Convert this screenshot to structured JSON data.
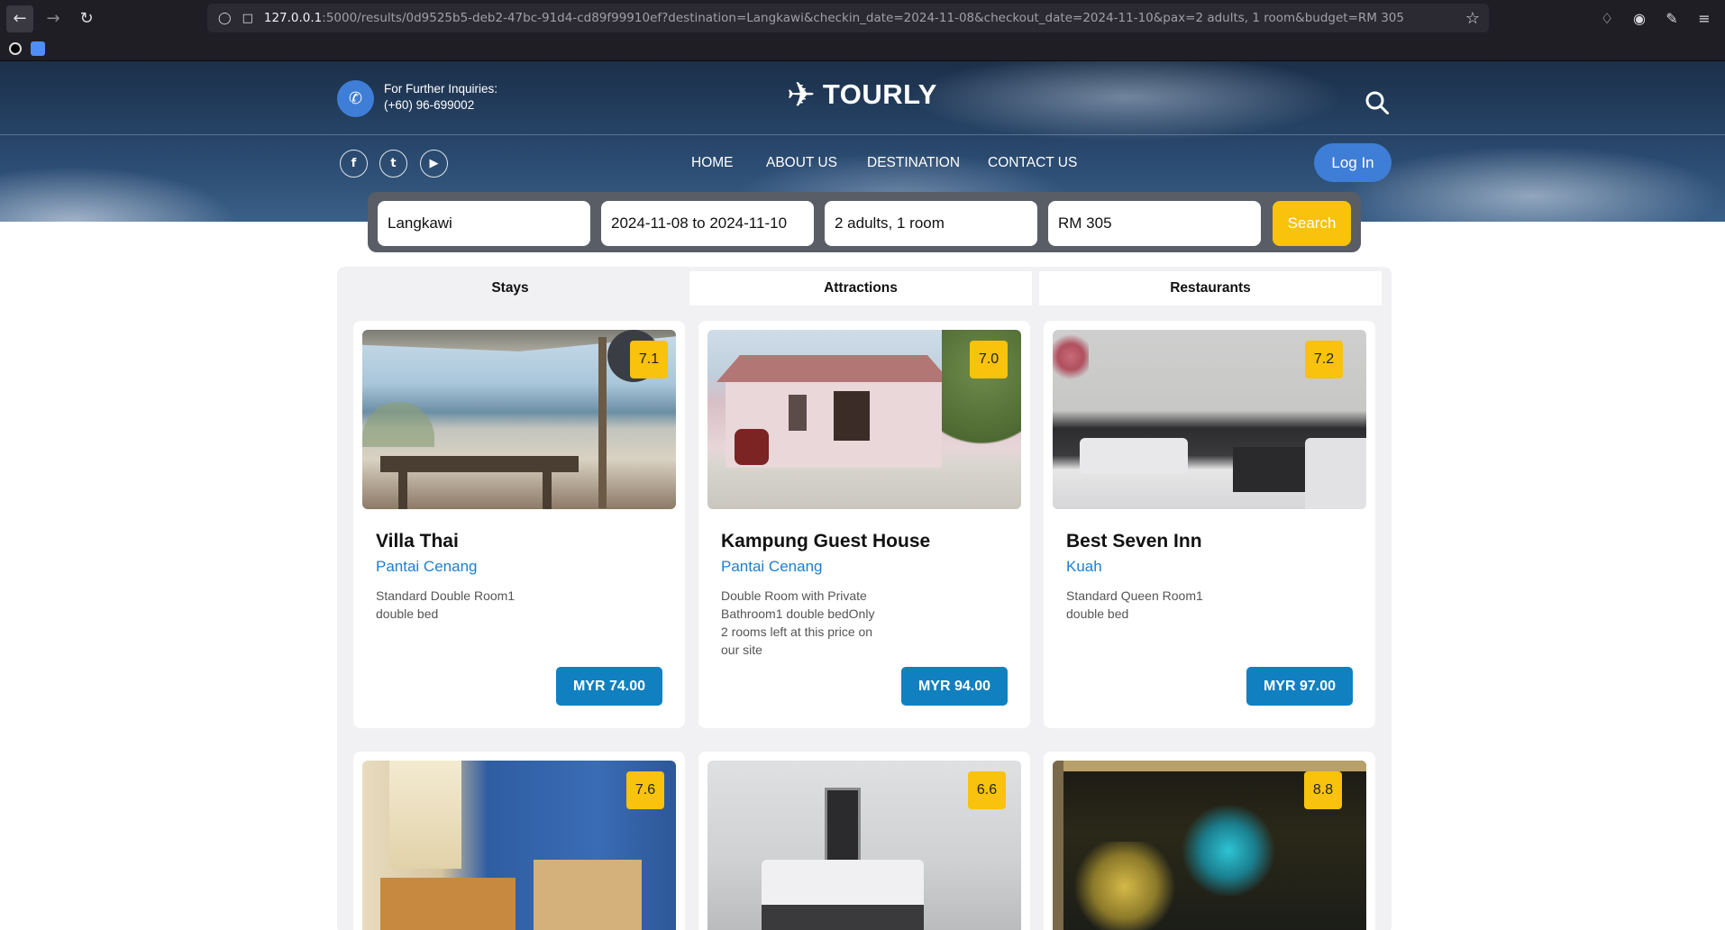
{
  "browser": {
    "url_host": "127.0.0.1",
    "url_rest": ":5000/results/0d9525b5-deb2-47bc-91d4-cd89f99910ef?destination=Langkawi&checkin_date=2024-11-08&checkout_date=2024-11-10&pax=2 adults, 1 room&budget=RM 305"
  },
  "header": {
    "inquiry_label": "For Further Inquiries:",
    "inquiry_phone": "(+60) 96-699002",
    "logo_text": "TOURLY",
    "nav": [
      "HOME",
      "ABOUT US",
      "DESTINATION",
      "CONTACT US"
    ],
    "login_label": "Log In"
  },
  "search": {
    "destination": "Langkawi",
    "dates": "2024-11-08 to 2024-11-10",
    "pax": "2 adults, 1 room",
    "budget": "RM 305",
    "button_label": "Search"
  },
  "tabs": [
    "Stays",
    "Attractions",
    "Restaurants"
  ],
  "stays": [
    {
      "name": "Villa Thai",
      "location": "Pantai Cenang",
      "description": "Standard Double Room1 double bed",
      "price": "MYR 74.00",
      "rating": "7.1"
    },
    {
      "name": "Kampung Guest House",
      "location": "Pantai Cenang",
      "description": "Double Room with Private Bathroom1 double bedOnly 2 rooms left at this price on our site",
      "price": "MYR 94.00",
      "rating": "7.0"
    },
    {
      "name": "Best Seven Inn",
      "location": "Kuah",
      "description": "Standard Queen Room1 double bed",
      "price": "MYR 97.00",
      "rating": "7.2"
    },
    {
      "rating": "7.6"
    },
    {
      "rating": "6.6"
    },
    {
      "rating": "8.8"
    }
  ]
}
